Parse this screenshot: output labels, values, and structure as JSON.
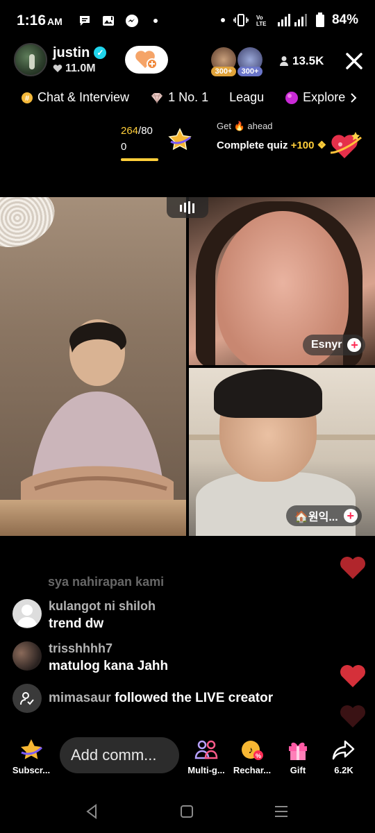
{
  "status_bar": {
    "time": "1:16",
    "ampm": "AM",
    "battery": "84%",
    "icons": [
      "chat-bubble-icon",
      "image-alert-icon",
      "messenger-icon",
      "dot-icon",
      "vibrate-icon",
      "volte-icon",
      "signal-icon",
      "battery-icon"
    ]
  },
  "host": {
    "name": "justin",
    "likes": "11.0M"
  },
  "viewers": {
    "badge_1": "300+",
    "badge_2": "300+",
    "count": "13.5K"
  },
  "ranking": {
    "items": [
      {
        "label": "Chat & Interview",
        "icon": "chat-coin-icon"
      },
      {
        "label": "1 No. 1",
        "icon": "diamond-icon"
      },
      {
        "label": "Leagu",
        "icon": ""
      },
      {
        "label": "Explore",
        "icon": "explore-orb-icon"
      }
    ]
  },
  "goal": {
    "current": "264",
    "total": "/80",
    "zero": "0",
    "progress_fraction": 1.0
  },
  "quiz": {
    "line1_pre": "Get",
    "line1_post": "ahead",
    "line2": "Complete quiz",
    "points": "+100"
  },
  "participants": [
    {
      "name": "Esnyr"
    },
    {
      "name": "🏠원익..."
    }
  ],
  "comments": {
    "faded": "sya nahirapan kami",
    "items": [
      {
        "user": "kulangot ni shiloh",
        "text": "trend dw"
      },
      {
        "user": "trisshhhh7",
        "text": "matulog kana Jahh"
      }
    ],
    "follow_event": {
      "user": "mimasaur",
      "text": "followed the LIVE creator"
    }
  },
  "bottom_bar": {
    "subscribe": "Subscr...",
    "comment_placeholder": "Add comm...",
    "multi_guest": "Multi-g...",
    "recharge": "Rechar...",
    "gift": "Gift",
    "share": "6.2K"
  },
  "colors": {
    "accent_red": "#fe2c55",
    "gold": "#ffce3a",
    "verified": "#20d5ec",
    "heart": "#c2272d"
  }
}
